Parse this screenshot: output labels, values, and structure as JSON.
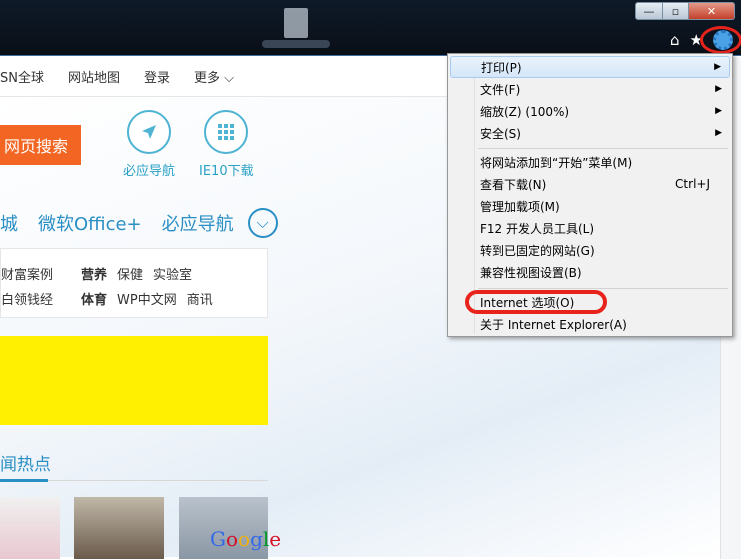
{
  "window": {
    "controls": {
      "minimize": "—",
      "maximize": "▫",
      "close": "✕"
    },
    "icons": [
      "home-icon",
      "favorites-star-icon",
      "tools-gear-icon"
    ],
    "accent": "#2a8fc4"
  },
  "page": {
    "nav": [
      "SN全球",
      "网站地图",
      "登录",
      "更多 ⌵"
    ],
    "search_button": "网页搜索",
    "quick_links": [
      {
        "label": "必应导航",
        "icon": "navigate-arrow-icon"
      },
      {
        "label": "IE10下载",
        "icon": "grid-icon"
      }
    ],
    "feature_links": [
      "城",
      "微软Office+",
      "必应导航"
    ],
    "categories": {
      "row1": [
        "财富案例",
        "营养",
        "保健",
        "实验室"
      ],
      "row2": [
        "白领钱经",
        "体育",
        "WP中文网",
        "商讯"
      ]
    },
    "hot_title": "闻热点",
    "thumb_text": "Google"
  },
  "menu": {
    "items": [
      {
        "label": "打印(P)",
        "arrow": "▶",
        "highlighted": true
      },
      {
        "label": "文件(F)",
        "arrow": "▶"
      },
      {
        "label": "缩放(Z) (100%)",
        "arrow": "▶"
      },
      {
        "label": "安全(S)",
        "arrow": "▶"
      },
      {
        "label": "将网站添加到“开始”菜单(M)"
      },
      {
        "label": "查看下载(N)",
        "shortcut": "Ctrl+J"
      },
      {
        "label": "管理加载项(M)"
      },
      {
        "label": "F12 开发人员工具(L)"
      },
      {
        "label": "转到已固定的网站(G)"
      },
      {
        "label": "兼容性视图设置(B)"
      },
      {
        "label": "Internet 选项(O)"
      },
      {
        "label": "关于 Internet Explorer(A)"
      }
    ]
  }
}
